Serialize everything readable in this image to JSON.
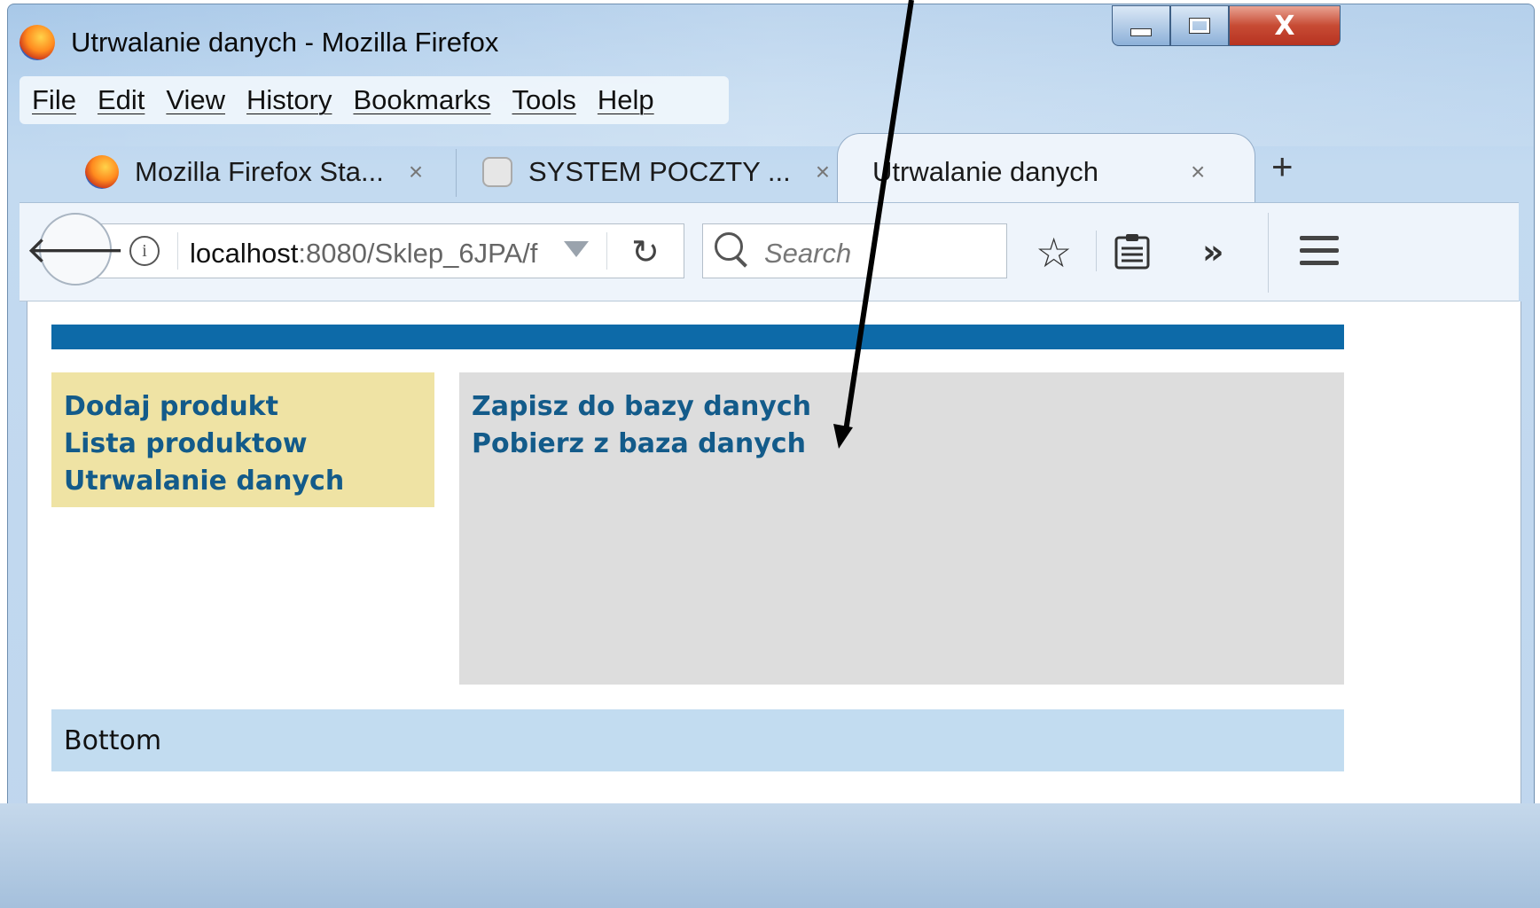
{
  "window": {
    "title": "Utrwalanie danych - Mozilla Firefox",
    "close_glyph": "X"
  },
  "menu": [
    "File",
    "Edit",
    "View",
    "History",
    "Bookmarks",
    "Tools",
    "Help"
  ],
  "tabs": [
    {
      "label": "Mozilla Firefox Sta...",
      "close": "×"
    },
    {
      "label": "SYSTEM POCZTY ...",
      "close": "×"
    },
    {
      "label": "Utrwalanie danych",
      "close": "×",
      "active": true
    }
  ],
  "new_tab": "+",
  "navbar": {
    "url_host": "localhost",
    "url_rest": ":8080/Sklep_6JPA/f",
    "search_placeholder": "Search"
  },
  "page": {
    "left_links": [
      "Dodaj produkt",
      "Lista produktow",
      "Utrwalanie danych"
    ],
    "main_links": [
      "Zapisz do bazy danych",
      "Pobierz z baza danych"
    ],
    "footer": "Bottom"
  },
  "colors": {
    "header_band": "#0d6aa8",
    "left_nav_bg": "#efe3a4",
    "main_pane_bg": "#dddddd",
    "footer_bg": "#c2dcf0",
    "link_color": "#135b8a"
  }
}
